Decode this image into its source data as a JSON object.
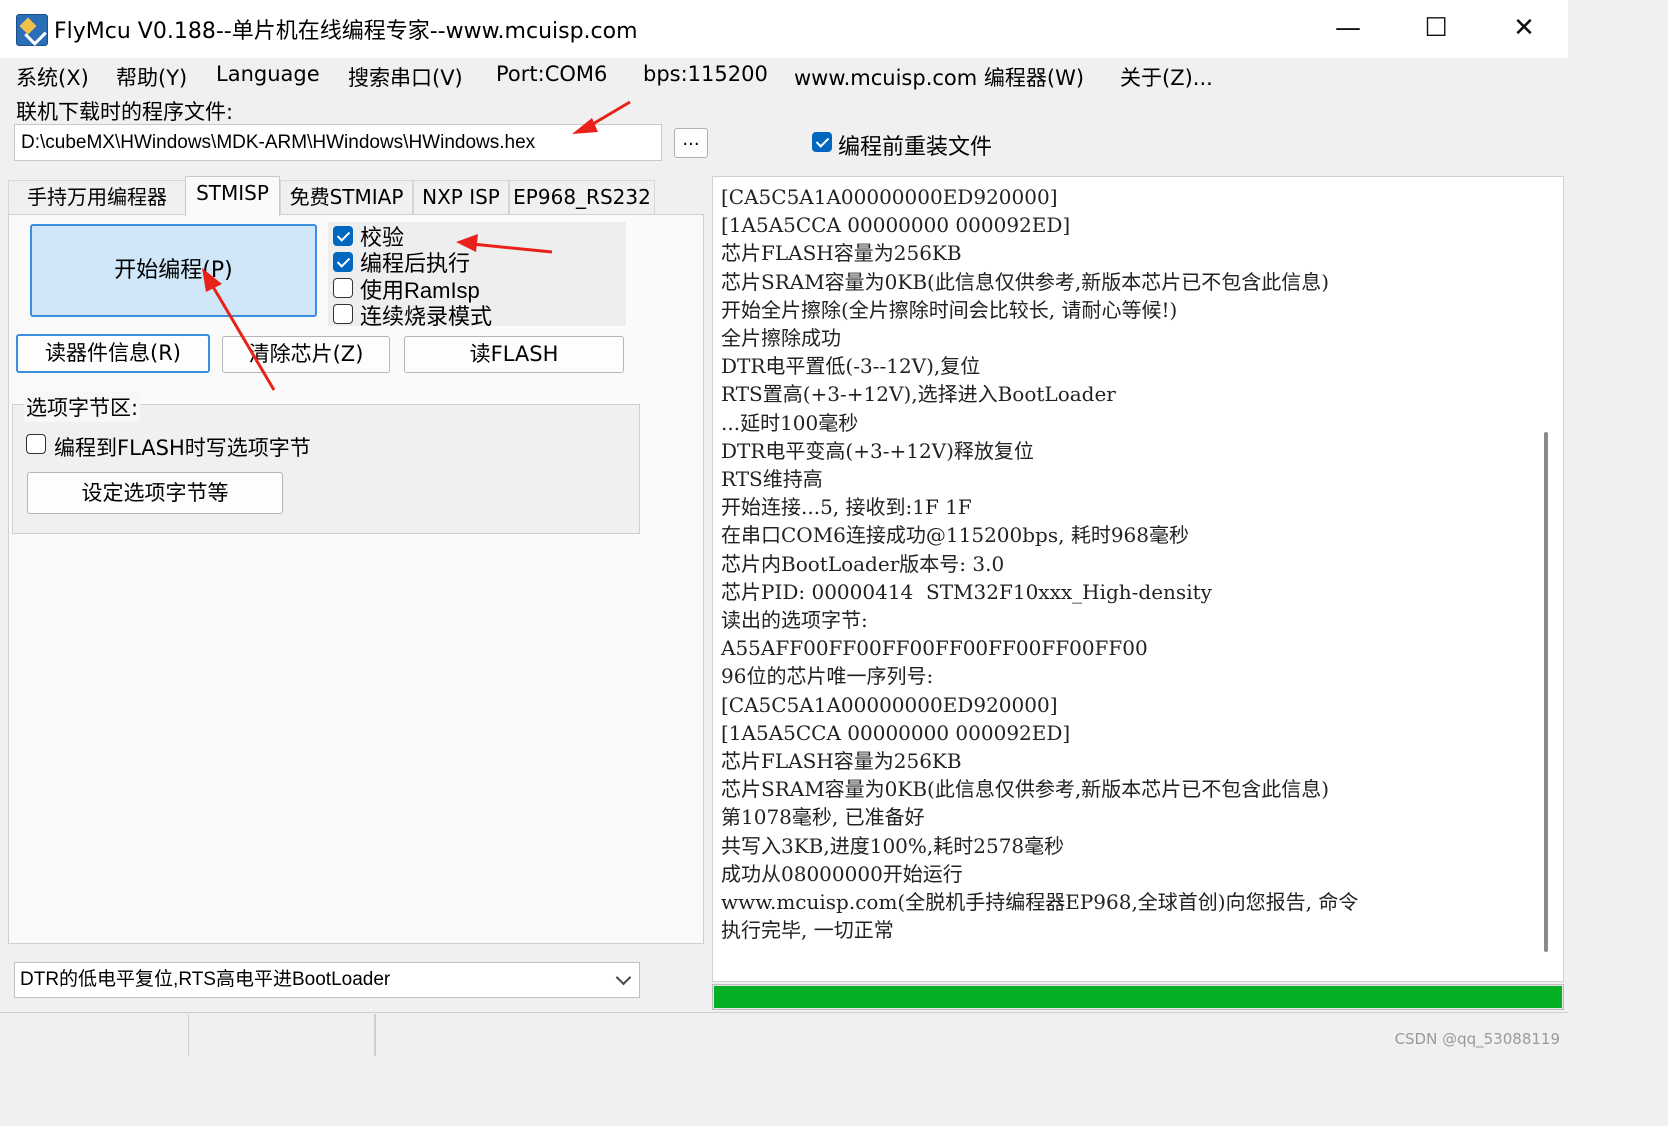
{
  "window": {
    "title": "FlyMcu V0.188--单片机在线编程专家--www.mcuisp.com",
    "minimize": "—",
    "maximize": "☐",
    "close": "✕",
    "icon": "flymcu-app-icon"
  },
  "menu": [
    "系统(X)",
    "帮助(Y)",
    "Language",
    "搜索串口(V)",
    "Port:COM6",
    "bps:115200",
    "www.mcuisp.com 编程器(W)",
    "关于(Z)..."
  ],
  "file": {
    "label": "联机下载时的程序文件:",
    "path": "D:\\cubeMX\\HWindows\\MDK-ARM\\HWindows\\HWindows.hex",
    "browse": "...",
    "reload_label": "编程前重装文件",
    "reload_checked": true
  },
  "tabs": [
    "手持万用编程器",
    "STMISP",
    "免费STMIAP",
    "NXP ISP",
    "EP968_RS232"
  ],
  "active_tab": "STMISP",
  "stmisp": {
    "start_button": "开始编程(P)",
    "options": [
      {
        "label": "校验",
        "checked": true
      },
      {
        "label": "编程后执行",
        "checked": true
      },
      {
        "label": "使用RamIsp",
        "checked": false
      },
      {
        "label": "连续烧录模式",
        "checked": false
      }
    ],
    "read_info_button": "读器件信息(R)",
    "erase_button": "清除芯片(Z)",
    "read_flash_button": "读FLASH",
    "option_bytes": {
      "title": "选项字节区:",
      "write_label": "编程到FLASH时写选项字节",
      "write_checked": false,
      "settings_button": "设定选项字节等"
    }
  },
  "reset_mode": "DTR的低电平复位,RTS高电平进BootLoader",
  "log": [
    "[CA5C5A1A00000000ED920000]",
    "[1A5A5CCA 00000000 000092ED]",
    "芯片FLASH容量为256KB",
    "芯片SRAM容量为0KB(此信息仅供参考,新版本芯片已不包含此信息)",
    "开始全片擦除(全片擦除时间会比较长, 请耐心等候!)",
    "全片擦除成功",
    "DTR电平置低(-3--12V),复位",
    "RTS置高(+3-+12V),选择进入BootLoader",
    "...延时100毫秒",
    "DTR电平变高(+3-+12V)释放复位",
    "RTS维持高",
    "开始连接...5, 接收到:1F 1F",
    "在串口COM6连接成功@115200bps, 耗时968毫秒",
    "芯片内BootLoader版本号: 3.0",
    "芯片PID: 00000414  STM32F10xxx_High-density",
    "读出的选项字节:",
    "A55AFF00FF00FF00FF00FF00FF00FF00",
    "96位的芯片唯一序列号:",
    "[CA5C5A1A00000000ED920000]",
    "[1A5A5CCA 00000000 000092ED]",
    "芯片FLASH容量为256KB",
    "芯片SRAM容量为0KB(此信息仅供参考,新版本芯片已不包含此信息)",
    "第1078毫秒, 已准备好",
    "共写入3KB,进度100%,耗时2578毫秒",
    "成功从08000000开始运行",
    "www.mcuisp.com(全脱机手持编程器EP968,全球首创)向您报告, 命令",
    "执行完毕, 一切正常"
  ],
  "progress": 1.0,
  "colors": {
    "progress": "#06b025",
    "accent": "#0067c0",
    "annotation_arrow": "#e8221b"
  },
  "watermark": "CSDN @qq_53088119"
}
